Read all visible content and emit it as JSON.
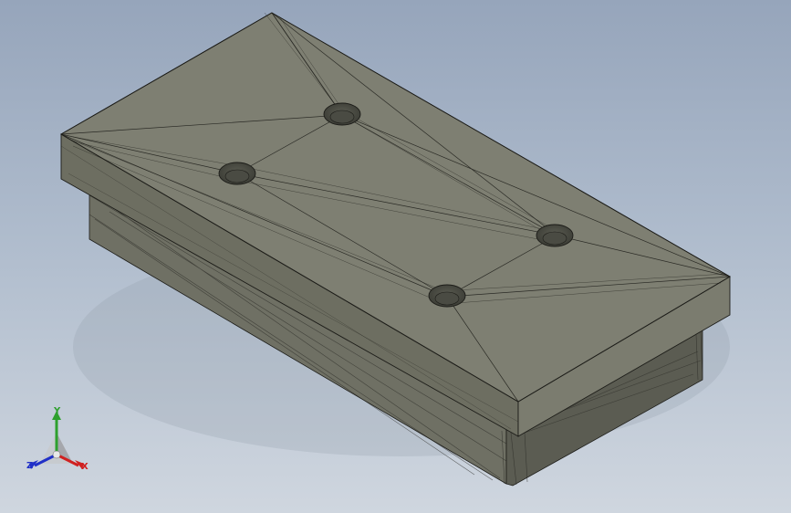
{
  "viewport": {
    "background_top": "#96a5bb",
    "background_bottom": "#cfd6df"
  },
  "model": {
    "body_color": "#7a7b6d",
    "edge_color": "#1c1c18"
  },
  "triad": {
    "x_label": "X",
    "y_label": "Y",
    "z_label": "Z",
    "x_color": "#d02020",
    "y_color": "#2ea02e",
    "z_color": "#2030c8"
  }
}
